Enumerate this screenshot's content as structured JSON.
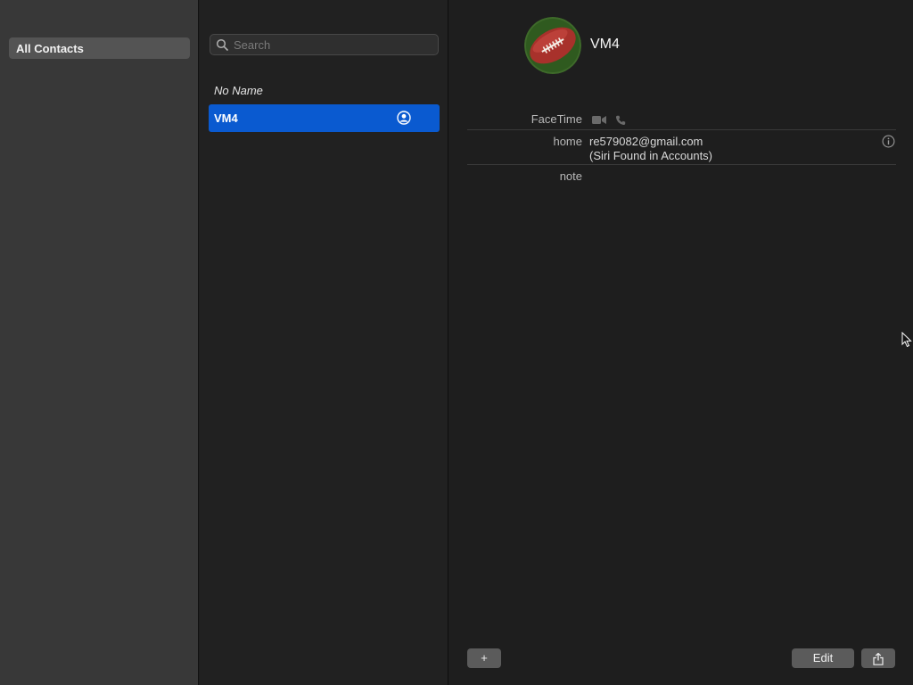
{
  "groups": {
    "items": [
      {
        "label": "All Contacts",
        "selected": true
      }
    ]
  },
  "list": {
    "search_placeholder": "Search",
    "contacts": [
      {
        "label": "No Name",
        "selected": false
      },
      {
        "label": "VM4",
        "selected": true,
        "icon": "person-circle-icon"
      }
    ]
  },
  "detail": {
    "name": "VM4",
    "avatar_icon": "football-avatar",
    "facetime_label": "FaceTime",
    "facetime_icons": [
      "video-camera-icon",
      "phone-icon"
    ],
    "email_label": "home",
    "email_value": "re579082@gmail.com",
    "email_source": "(Siri Found in Accounts)",
    "note_label": "note"
  },
  "buttons": {
    "add": "+",
    "edit": "Edit",
    "share_icon": "share-icon"
  },
  "colors": {
    "selection": "#0a5ad0",
    "sidebar_bg": "#383838",
    "list_bg": "#212121",
    "detail_bg": "#1e1e1e"
  }
}
